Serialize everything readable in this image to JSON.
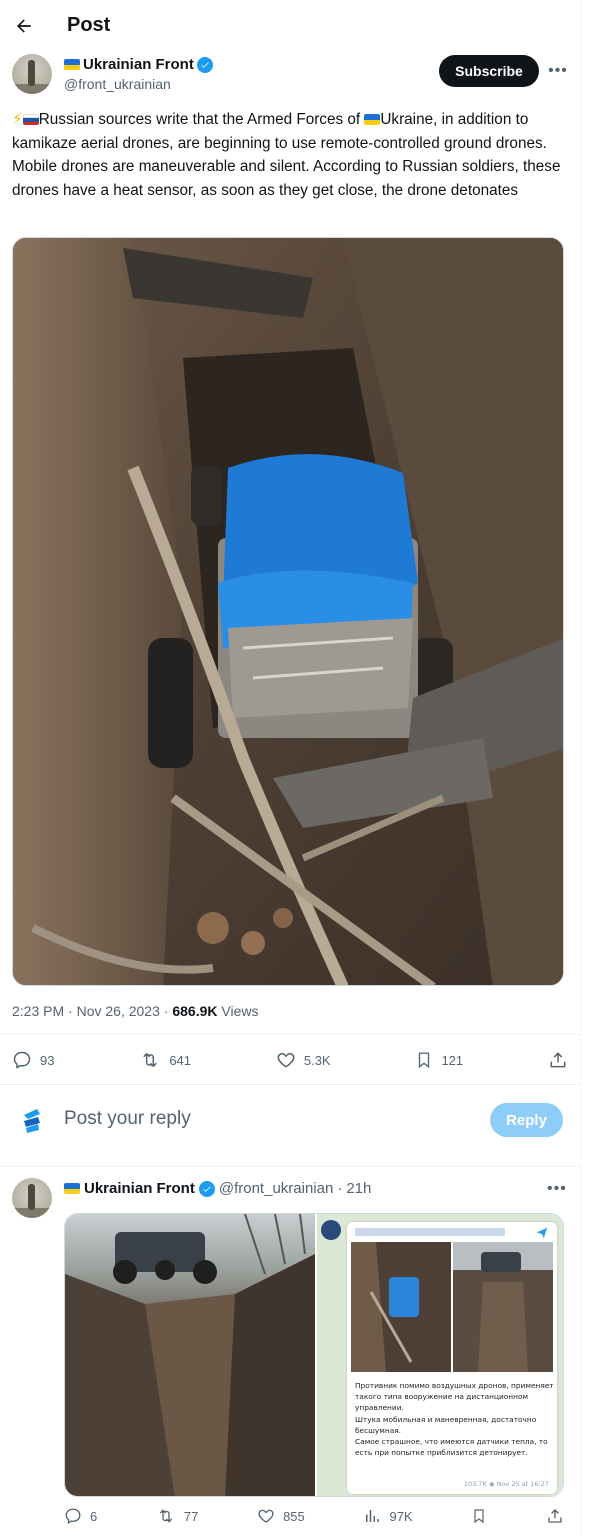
{
  "header": {
    "title": "Post"
  },
  "post": {
    "author": {
      "name": "Ukrainian Front",
      "handle": "@front_ukrainian"
    },
    "subscribe_label": "Subscribe",
    "text_before_flag": "Russian sources write that the Armed Forces of ",
    "text_after_flag": "Ukraine, in addition to kamikaze aerial drones, are beginning to use remote-controlled ground drones. Mobile drones are maneuverable and silent. According to Russian soldiers, these drones have a heat sensor, as soon as they get close, the drone detonates",
    "time": "2:23 PM",
    "date": "Nov 26, 2023",
    "views_count": "686.9K",
    "views_label": "Views",
    "stats": {
      "replies": "93",
      "reposts": "641",
      "likes": "5.3K",
      "bookmarks": "121"
    }
  },
  "reply_box": {
    "placeholder": "Post your reply",
    "button_label": "Reply"
  },
  "reply": {
    "author": {
      "name": "Ukrainian Front",
      "handle": "@front_ukrainian",
      "time": "21h"
    },
    "telegram_text": "Противник помимо воздушных дронов, применяет такого типа вооружение на дистанционном управлении.\nШтука мобильная и маневренная, достаточно бесшумная.\nСамое страшное, что имеются датчики тепла, то есть при попытке приблизится детонирует.",
    "telegram_meta": "103.7K ◉  Nov 25 at 16:27",
    "stats": {
      "replies": "6",
      "reposts": "77",
      "likes": "855",
      "views": "97K"
    }
  },
  "colors": {
    "accent": "#1d9bf0",
    "reply_button": "#8ecdf8",
    "text_secondary": "#536471"
  }
}
